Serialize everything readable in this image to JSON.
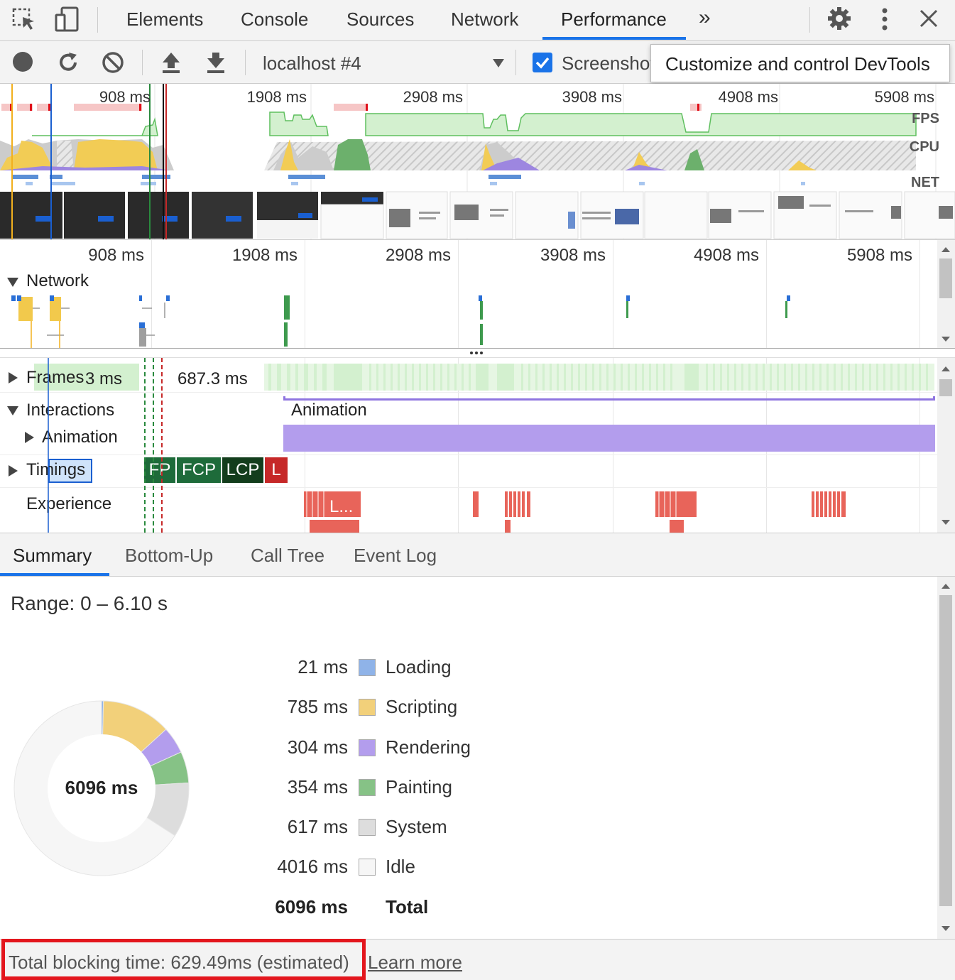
{
  "tabs": {
    "items": [
      "Elements",
      "Console",
      "Sources",
      "Network",
      "Performance"
    ],
    "active": "Performance",
    "overflow_glyph": "»"
  },
  "toolbar": {
    "profile_select": "localhost #4",
    "screenshots_label": "Screenshots",
    "screenshots_checked": true,
    "tooltip": "Customize and control DevTools"
  },
  "overview": {
    "ticks": [
      "908 ms",
      "1908 ms",
      "2908 ms",
      "3908 ms",
      "4908 ms",
      "5908 ms"
    ],
    "labels": {
      "fps": "FPS",
      "cpu": "CPU",
      "net": "NET"
    }
  },
  "timeline": {
    "ticks": [
      "908 ms",
      "1908 ms",
      "2908 ms",
      "3908 ms",
      "4908 ms",
      "5908 ms"
    ],
    "network_label": "Network",
    "frames_label": "Frames",
    "frames_value_1": "3 ms",
    "frames_value_2": "687.3 ms",
    "interactions_label": "Interactions",
    "animation_label": "Animation",
    "animation_bar_label": "Animation",
    "timings_label": "Timings",
    "timing_chips": [
      "FP",
      "FCP",
      "LCP",
      "L"
    ],
    "experience_label": "Experience",
    "experience_chip_label": "L..."
  },
  "bottom_tabs": {
    "items": [
      "Summary",
      "Bottom-Up",
      "Call Tree",
      "Event Log"
    ],
    "active": "Summary"
  },
  "summary": {
    "range": "Range: 0 – 6.10 s",
    "donut_total": "6096 ms",
    "rows": [
      {
        "value": "21 ms",
        "name": "Loading",
        "color": "#8fb3e8"
      },
      {
        "value": "785 ms",
        "name": "Scripting",
        "color": "#f2d07a"
      },
      {
        "value": "304 ms",
        "name": "Rendering",
        "color": "#b39ded"
      },
      {
        "value": "354 ms",
        "name": "Painting",
        "color": "#86c286"
      },
      {
        "value": "617 ms",
        "name": "System",
        "color": "#dddddd"
      },
      {
        "value": "4016 ms",
        "name": "Idle",
        "color": "#f6f6f6"
      }
    ],
    "total_value": "6096 ms",
    "total_label": "Total"
  },
  "footer": {
    "tbt": "Total blocking time: 629.49ms (estimated)",
    "learn_more": "Learn more"
  },
  "colors": {
    "accent": "#1a73e8",
    "highlight_box": "#e3161d",
    "scripting": "#f2d07a",
    "rendering": "#b39ded",
    "painting": "#86c286",
    "fps_green": "#d3f0cf",
    "fps_line": "#5fbf5f",
    "timing_dark_green": "#1e6b3a",
    "timing_lcp": "#133d1c",
    "timing_l": "#c62828",
    "experience_red": "#e8645a",
    "animation_purple": "#b39ded"
  }
}
